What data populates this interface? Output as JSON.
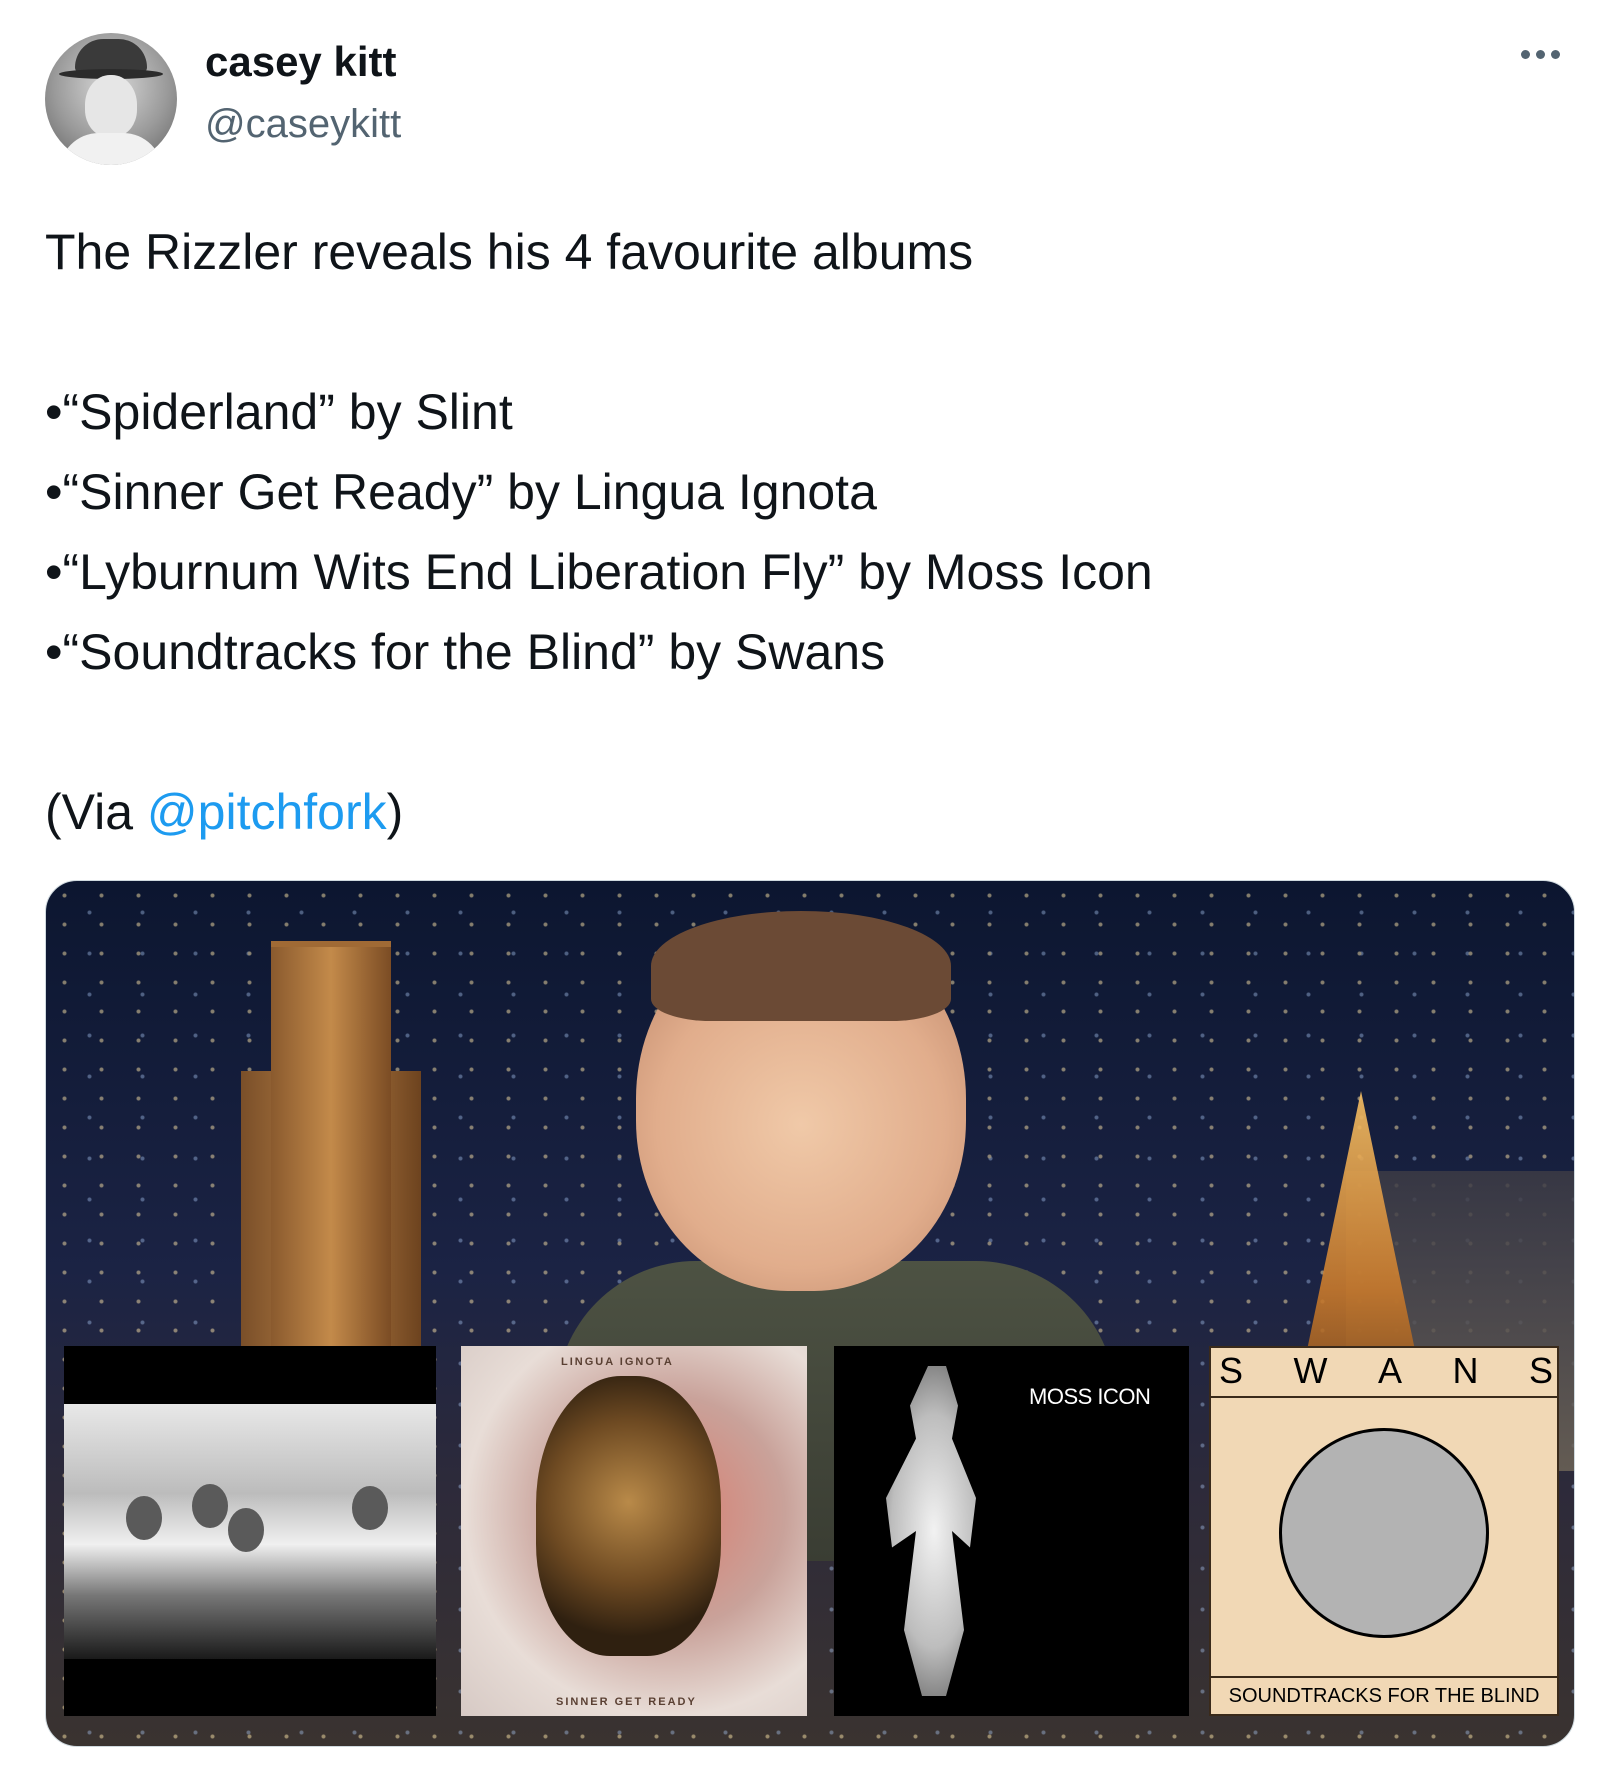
{
  "author": {
    "display_name": "casey kitt",
    "handle": "@caseykitt"
  },
  "tweet": {
    "intro": "The Rizzler reveals his 4 favourite albums",
    "items": [
      "•“Spiderland” by Slint",
      "•“Sinner Get Ready” by Lingua Ignota",
      "•“Lyburnum Wits End Liberation Fly” by Moss Icon",
      "•“Soundtracks for the Blind” by Swans"
    ],
    "via_prefix": "(Via ",
    "via_link": "@pitchfork",
    "via_suffix": ")"
  },
  "albums": {
    "lingua_top": "LINGUA IGNOTA",
    "lingua_bottom": "SINNER GET READY",
    "moss_icon": "MOSS ICON",
    "swans_letters": [
      "S",
      "W",
      "A",
      "N",
      "S"
    ],
    "swans_subtitle": "SOUNDTRACKS FOR THE BLIND"
  },
  "colors": {
    "link": "#1d9bf0",
    "secondary_text": "#536471",
    "primary_text": "#0f1419"
  }
}
